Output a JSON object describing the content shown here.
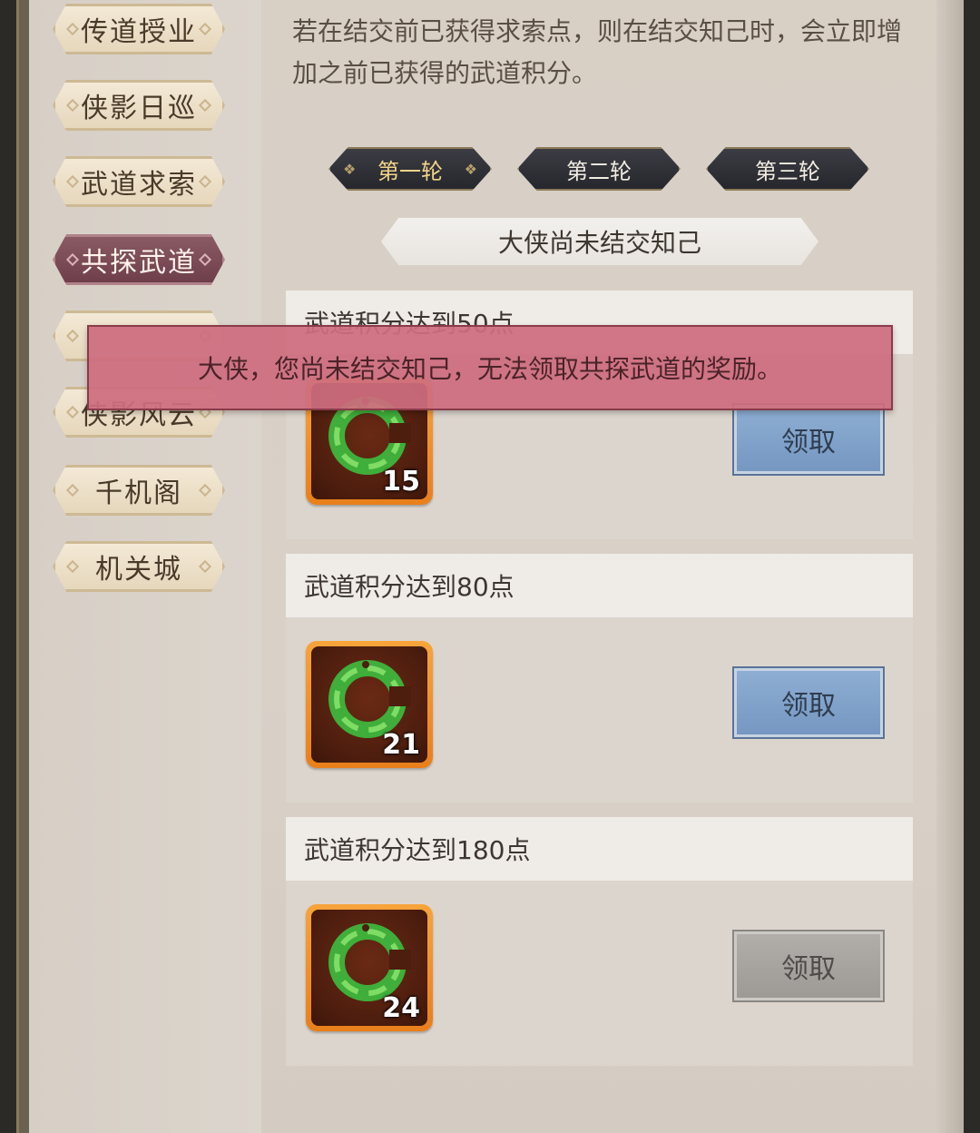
{
  "sidebar": {
    "tabs": [
      {
        "label": "传道授业",
        "active": false
      },
      {
        "label": "侠影日巡",
        "active": false
      },
      {
        "label": "武道求索",
        "active": false
      },
      {
        "label": "共探武道",
        "active": true
      },
      {
        "label": "",
        "active": false
      },
      {
        "label": "侠影风云",
        "active": false
      },
      {
        "label": "千机阁",
        "active": false
      },
      {
        "label": "机关城",
        "active": false
      }
    ]
  },
  "description": "若在结交前已获得求索点，则在结交知己时，会立即增加之前已获得的武道积分。",
  "rounds": [
    {
      "label": "第一轮",
      "active": true
    },
    {
      "label": "第二轮",
      "active": false
    },
    {
      "label": "第三轮",
      "active": false
    }
  ],
  "status_banner": "大侠尚未结交知己",
  "rewards": [
    {
      "title": "武道积分达到50点",
      "item": "jade-pendant-icon",
      "quantity": "15",
      "button": "领取",
      "enabled": true
    },
    {
      "title": "武道积分达到80点",
      "item": "jade-pendant-icon",
      "quantity": "21",
      "button": "领取",
      "enabled": true
    },
    {
      "title": "武道积分达到180点",
      "item": "jade-pendant-icon",
      "quantity": "24",
      "button": "领取",
      "enabled": false
    }
  ],
  "toast": "大侠，您尚未结交知己，无法领取共探武道的奖励。",
  "colors": {
    "active_tab": "#7a4a55",
    "claim_button": "#7f9fc8",
    "claim_disabled": "#a7a4a0",
    "toast": "#cd6d7e",
    "item_frame": "#f08f2a"
  }
}
